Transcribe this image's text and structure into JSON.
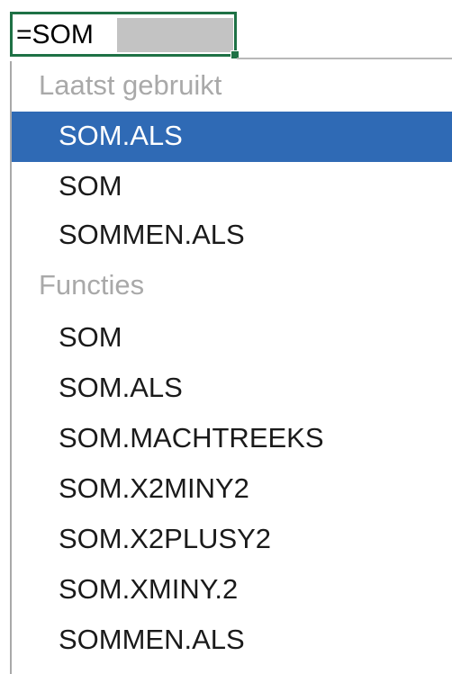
{
  "cell": {
    "typed_text": "=SOM"
  },
  "colors": {
    "cell_border": "#1e7145",
    "selection": "#2f6ab5",
    "section_header": "#a9a9a9",
    "autocomplete_ghost": "#c3c3c3"
  },
  "dropdown": {
    "recent_header": "Laatst gebruikt",
    "recent_items": [
      "SOM.ALS",
      "SOM",
      "SOMMEN.ALS"
    ],
    "selected_item": "SOM.ALS",
    "functions_header": "Functies",
    "function_items": [
      "SOM",
      "SOM.ALS",
      "SOM.MACHTREEKS",
      "SOM.X2MINY2",
      "SOM.X2PLUSY2",
      "SOM.XMINY.2",
      "SOMMEN.ALS"
    ]
  }
}
